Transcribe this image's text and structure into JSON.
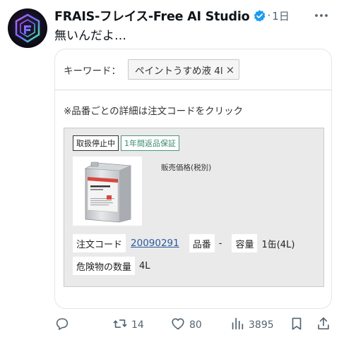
{
  "post": {
    "author_name": "FRAIS-フレイス-Free AI Studio",
    "separator": "·",
    "time": "1日",
    "text": "無いんだよ…"
  },
  "card": {
    "keyword_label": "キーワード：",
    "keyword_chip": "ペイントうすめ液 4l",
    "keyword_close": "×",
    "note": "※品番ごとの詳細は注文コードをクリック",
    "badges": {
      "discontinued": "取扱停止中",
      "return_guarantee": "1年間返品保証"
    },
    "price_label": "販売価格(税別)",
    "specs": {
      "order_code_label": "注文コード",
      "order_code_value": "20090291",
      "part_no_label": "品番",
      "part_no_value": "-",
      "capacity_label": "容量",
      "capacity_value": "1缶(4L)",
      "hazard_label": "危険物の数量",
      "hazard_value": "4L"
    }
  },
  "actions": {
    "reply_count": "",
    "repost_count": "14",
    "like_count": "80",
    "views_count": "3895"
  },
  "colors": {
    "verified": "#1d9bf0",
    "link": "#2c5aa0",
    "return_badge": "#3a8a68",
    "icon_gray": "#536471"
  },
  "icons": [
    "verified-badge-icon",
    "more-icon",
    "reply-icon",
    "repost-icon",
    "like-icon",
    "views-icon",
    "bookmark-icon",
    "share-icon"
  ]
}
